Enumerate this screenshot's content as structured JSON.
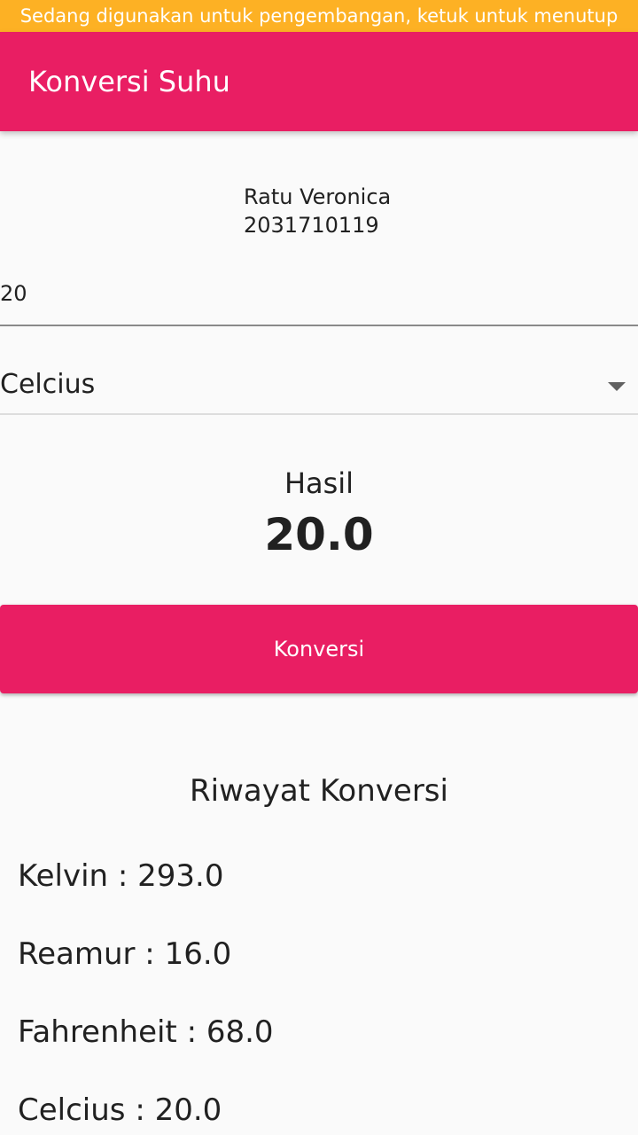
{
  "dev_banner": {
    "text": "Sedang digunakan untuk pengembangan, ketuk untuk menutup",
    "color": "#FDB124"
  },
  "app_bar": {
    "title": "Konversi Suhu",
    "color": "#E91E63"
  },
  "identity": {
    "name": "Ratu Veronica",
    "id": "2031710119"
  },
  "input": {
    "value": "20"
  },
  "unit_select": {
    "selected": "Celcius",
    "icon": "arrow-drop-down-icon"
  },
  "result": {
    "label": "Hasil",
    "value": "20.0"
  },
  "convert_button": {
    "label": "Konversi"
  },
  "history": {
    "title": "Riwayat Konversi",
    "items": [
      "Kelvin : 293.0",
      "Reamur : 16.0",
      "Fahrenheit : 68.0",
      "Celcius : 20.0"
    ]
  }
}
